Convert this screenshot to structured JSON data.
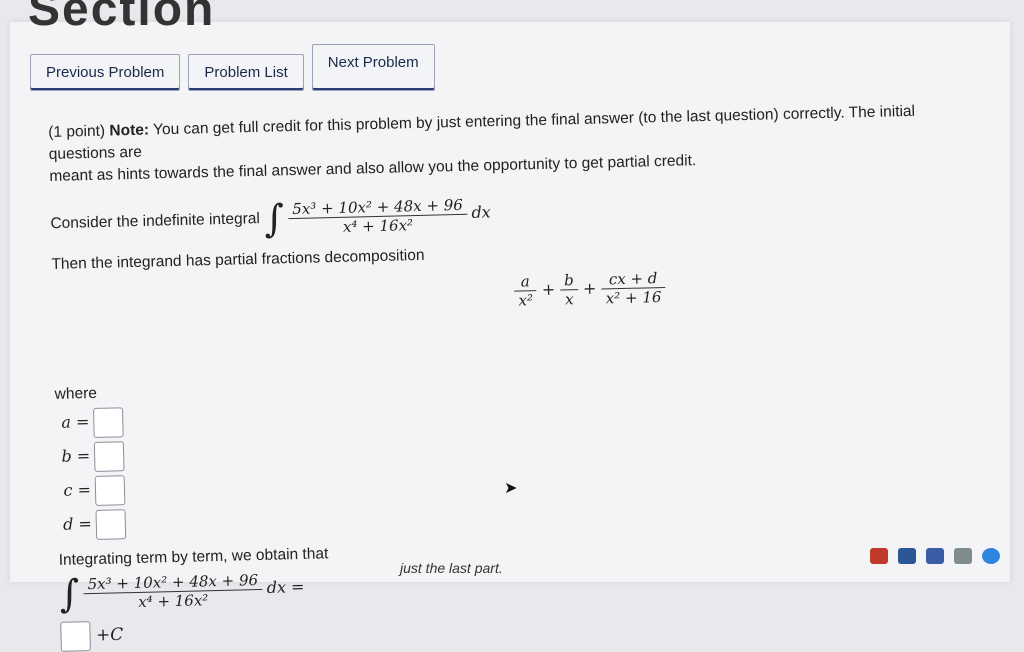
{
  "header": {
    "title_fragment": "Section"
  },
  "nav": {
    "previous": "Previous Problem",
    "list": "Problem List",
    "next": "Next Problem"
  },
  "problem": {
    "points": "(1 point)",
    "note_label": "Note:",
    "note_text": "You can get full credit for this problem by just entering the final answer (to the last question) correctly. The initial questions are",
    "note_text_2": "meant as hints towards the final answer and also allow you the opportunity to get partial credit.",
    "consider": "Consider the indefinite integral",
    "integrand_num": "5x³ + 10x² + 48x + 96",
    "integrand_den": "x⁴ + 16x²",
    "dx": "dx",
    "decomp_text": "Then the integrand has partial fractions decomposition",
    "decomp": {
      "t1_num": "a",
      "t1_den": "x²",
      "t2_num": "b",
      "t2_den": "x",
      "t3_num": "cx + d",
      "t3_den": "x² + 16",
      "plus": "+"
    },
    "where": "where",
    "vars": [
      "a =",
      "b =",
      "c =",
      "d ="
    ],
    "integrating": "Integrating term by term, we obtain that",
    "eq": "dx =",
    "plusc": "+C"
  },
  "footnote": "just the last part."
}
